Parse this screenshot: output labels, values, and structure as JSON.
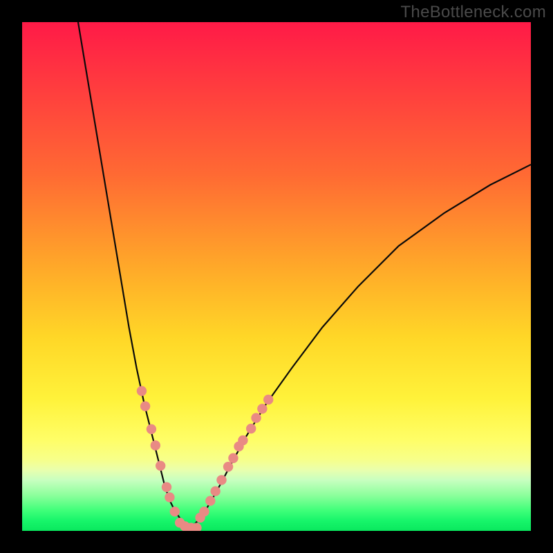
{
  "watermark": "TheBottleneck.com",
  "chart_data": {
    "type": "line",
    "title": "",
    "xlabel": "",
    "ylabel": "",
    "xlim": [
      0,
      100
    ],
    "ylim": [
      0,
      100
    ],
    "grid": false,
    "series": [
      {
        "name": "left-curve",
        "x": [
          11,
          13,
          15,
          17,
          19,
          21,
          22.5,
          24,
          25.5,
          27,
          28,
          29,
          30,
          31,
          32,
          33
        ],
        "y": [
          100,
          88,
          76,
          64,
          52,
          40,
          32,
          25,
          19,
          13,
          9,
          6,
          4,
          2.5,
          1.2,
          0.4
        ]
      },
      {
        "name": "right-curve",
        "x": [
          33,
          34,
          35.5,
          37,
          39,
          41,
          44,
          48,
          53,
          59,
          66,
          74,
          83,
          92,
          100
        ],
        "y": [
          0.4,
          1.4,
          3.2,
          5.6,
          9.2,
          13,
          18.5,
          25,
          32,
          40,
          48,
          56,
          62.5,
          68,
          72
        ]
      }
    ],
    "pink_markers_left": [
      {
        "x": 23.5,
        "y": 27.5
      },
      {
        "x": 24.2,
        "y": 24.5
      },
      {
        "x": 25.4,
        "y": 20.0
      },
      {
        "x": 26.2,
        "y": 16.8
      },
      {
        "x": 27.2,
        "y": 12.8
      },
      {
        "x": 28.4,
        "y": 8.6
      },
      {
        "x": 29.0,
        "y": 6.6
      },
      {
        "x": 30.0,
        "y": 3.8
      },
      {
        "x": 31.0,
        "y": 1.6
      },
      {
        "x": 32.0,
        "y": 0.9
      },
      {
        "x": 33.2,
        "y": 0.6
      },
      {
        "x": 34.3,
        "y": 0.6
      }
    ],
    "pink_markers_right": [
      {
        "x": 35.0,
        "y": 2.6
      },
      {
        "x": 35.8,
        "y": 3.8
      },
      {
        "x": 37.0,
        "y": 5.9
      },
      {
        "x": 38.0,
        "y": 7.8
      },
      {
        "x": 39.2,
        "y": 10.0
      },
      {
        "x": 40.5,
        "y": 12.6
      },
      {
        "x": 41.5,
        "y": 14.3
      },
      {
        "x": 42.6,
        "y": 16.6
      },
      {
        "x": 43.4,
        "y": 17.8
      },
      {
        "x": 45.0,
        "y": 20.1
      },
      {
        "x": 46.0,
        "y": 22.2
      },
      {
        "x": 47.2,
        "y": 24.0
      },
      {
        "x": 48.4,
        "y": 25.8
      }
    ],
    "gradient_stops": [
      {
        "pos": 0,
        "color": "#ff1a47"
      },
      {
        "pos": 12,
        "color": "#ff3a3f"
      },
      {
        "pos": 30,
        "color": "#ff6a33"
      },
      {
        "pos": 48,
        "color": "#ffa829"
      },
      {
        "pos": 62,
        "color": "#ffd727"
      },
      {
        "pos": 74,
        "color": "#fff23a"
      },
      {
        "pos": 82,
        "color": "#fffe66"
      },
      {
        "pos": 86,
        "color": "#f7ff8a"
      },
      {
        "pos": 88,
        "color": "#e9ffad"
      },
      {
        "pos": 90,
        "color": "#c8ffc0"
      },
      {
        "pos": 93,
        "color": "#8cff9c"
      },
      {
        "pos": 96,
        "color": "#3fff79"
      },
      {
        "pos": 98,
        "color": "#17f56a"
      },
      {
        "pos": 100,
        "color": "#0ae85e"
      }
    ],
    "marker_color": "#e98a84",
    "curve_color": "#0a0a0a"
  }
}
